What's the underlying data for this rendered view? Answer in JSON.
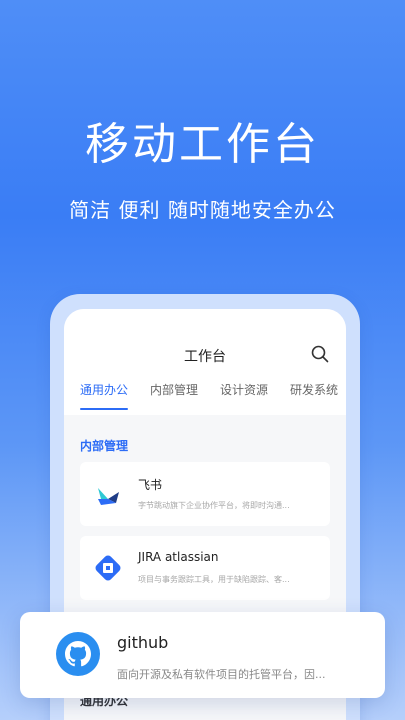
{
  "hero": {
    "title": "移动工作台",
    "subtitle": "简洁 便利 随时随地安全办公"
  },
  "phone": {
    "title": "工作台",
    "tabs": [
      {
        "label": "通用办公",
        "active": true
      },
      {
        "label": "内部管理",
        "active": false
      },
      {
        "label": "设计资源",
        "active": false
      },
      {
        "label": "研发系统",
        "active": false
      }
    ],
    "section_label": "内部管理",
    "apps": [
      {
        "name": "飞书",
        "description": "字节跳动旗下企业协作平台，将即时沟通...",
        "icon": "feishu-icon"
      },
      {
        "name": "JIRA atlassian",
        "description": "项目与事务跟踪工具，用于缺陷跟踪、客...",
        "icon": "jira-icon"
      }
    ],
    "section_label_2": "通用办公"
  },
  "featured_app": {
    "name": "github",
    "description": "面向开源及私有软件项目的托管平台，因...",
    "icon": "github-icon"
  },
  "colors": {
    "accent": "#2c6cf6",
    "background_top": "#4f8ef7",
    "background_bottom": "#b5cffb"
  }
}
